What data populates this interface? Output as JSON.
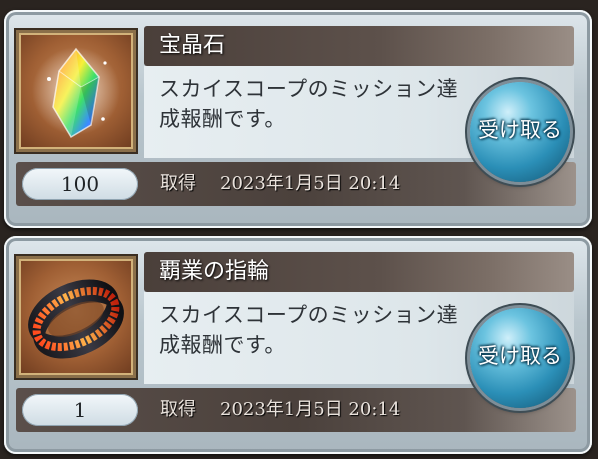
{
  "rewards": [
    {
      "name": "宝晶石",
      "description": "スカイスコープのミッション達成報酬です。",
      "quantity": "100",
      "obtain_label": "取得",
      "obtain_time": "2023年1月5日 20:14",
      "button_label": "受け取る",
      "icon": "crystal-icon"
    },
    {
      "name": "覇業の指輪",
      "description": "スカイスコープのミッション達成報酬です。",
      "quantity": "1",
      "obtain_label": "取得",
      "obtain_time": "2023年1月5日 20:14",
      "button_label": "受け取る",
      "icon": "ring-icon"
    }
  ],
  "colors": {
    "title_bar": "#4a3f3a",
    "button_blue": "#2b8fb7",
    "panel": "#dde6ea"
  }
}
